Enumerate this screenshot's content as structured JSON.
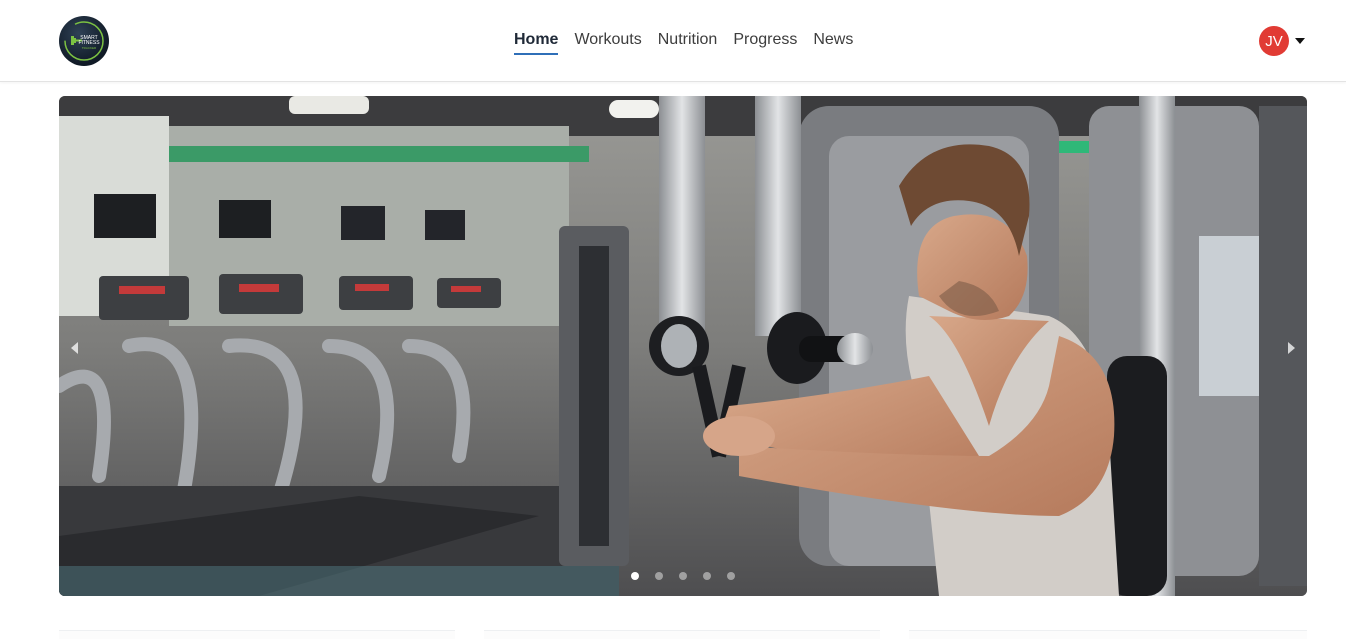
{
  "brand": {
    "logo_text_line1": "SMART",
    "logo_text_line2": "FITNESS",
    "logo_text_line3": "TRACKER",
    "icon": "dumbbell-logo-icon"
  },
  "nav": {
    "items": [
      {
        "label": "Home",
        "active": true
      },
      {
        "label": "Workouts",
        "active": false
      },
      {
        "label": "Nutrition",
        "active": false
      },
      {
        "label": "Progress",
        "active": false
      },
      {
        "label": "News",
        "active": false
      }
    ]
  },
  "user": {
    "initials": "JV",
    "avatar_color": "#e13b34",
    "menu_icon": "caret-down-icon"
  },
  "carousel": {
    "slide_count": 5,
    "active_index": 0,
    "prev_icon": "chevron-left-icon",
    "next_icon": "chevron-right-icon"
  },
  "colors": {
    "accent": "#2f6fb8",
    "nav_text": "#3d3d3d"
  }
}
